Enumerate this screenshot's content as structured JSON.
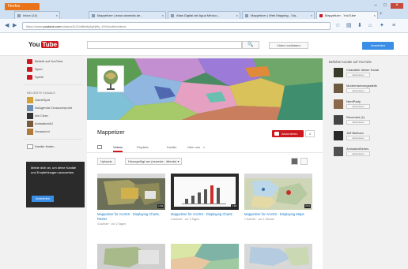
{
  "browser": {
    "firefox_label": "Firefox",
    "tabs": [
      {
        "label": "Inbox (14)"
      },
      {
        "label": "Mappetizer | www.uismedia.de..."
      },
      {
        "label": "Atlas Digital del Agua México..."
      },
      {
        "label": "Mappetizer | Web Mapping - Via..."
      },
      {
        "label": "Mappetizer - YouTube"
      }
    ],
    "new_tab": "+",
    "url_prefix": "https://www.",
    "url_host": "youtube.com",
    "url_rest": "/channel/UCtnt8w9y6gHjHy_6Yk4xz8w/videos"
  },
  "youtube": {
    "logo_you": "You",
    "logo_tube": "Tube",
    "search_button": "🔍",
    "upload_label": "Video hochladen",
    "signin_label": "Anmelden",
    "sidebar": {
      "items": [
        {
          "label": "Beliebt auf YouTube"
        },
        {
          "label": "Sport"
        },
        {
          "label": "Spiele"
        }
      ],
      "section_title": "BELIEBTE KANÄLE",
      "channels": [
        {
          "label": "GameSpot",
          "color": "#d4a136"
        },
        {
          "label": "NoAgenda Crossoverpoint",
          "color": "#6a8fb0"
        },
        {
          "label": "Am Chan",
          "color": "#333333"
        },
        {
          "label": "Animation4U",
          "color": "#7a5a3a"
        },
        {
          "label": "Vanaukoni",
          "color": "#b07a3a"
        }
      ],
      "browse_label": "Kanäle finden"
    },
    "promo": {
      "text": "Melde dich an, um deine Kanäle und Empfehlungen anzusehen.",
      "button": "Anmelden"
    },
    "channel": {
      "title": "Mappetizer",
      "subscribe": "Abonnieren",
      "count": "4",
      "tabs": [
        "Videos",
        "Playlists",
        "Kanäle",
        "Über uns"
      ],
      "filter_uploads": "Uploads",
      "filter_sort": "Hinzugefügt am (neueste - älteste) ▾",
      "videos": [
        {
          "title": "Mappetizer for ArcGIS - Displaying Charts, Raster",
          "meta": "4 Aufrufe · vor 2 Tagen",
          "duration": "1:39"
        },
        {
          "title": "Mappetizer for ArcGIS - Displaying Charts",
          "meta": "4 Aufrufe · vor 2 Tagen",
          "duration": "1:18"
        },
        {
          "title": "Mappetizer for ArcGIS - Displaying Maps",
          "meta": "7 Aufrufe · vor 1 Woche",
          "duration": "2:01"
        }
      ]
    },
    "right": {
      "title": "Beliebte Kanäle auf YouTube",
      "sub_label": "Abonnieren",
      "channels": [
        {
          "name": "Charakter dieser Kanal",
          "color": "#3a3a2a"
        },
        {
          "name": "Modernisierungsstelle",
          "color": "#6b5a40"
        },
        {
          "name": "NerdParty",
          "color": "#8a6a4a"
        },
        {
          "name": "Recorded (1)",
          "color": "#444444"
        },
        {
          "name": "Jeff Beilharz",
          "color": "#2a2a2a"
        },
        {
          "name": "AnimatedSeries",
          "color": "#505050"
        }
      ]
    }
  }
}
